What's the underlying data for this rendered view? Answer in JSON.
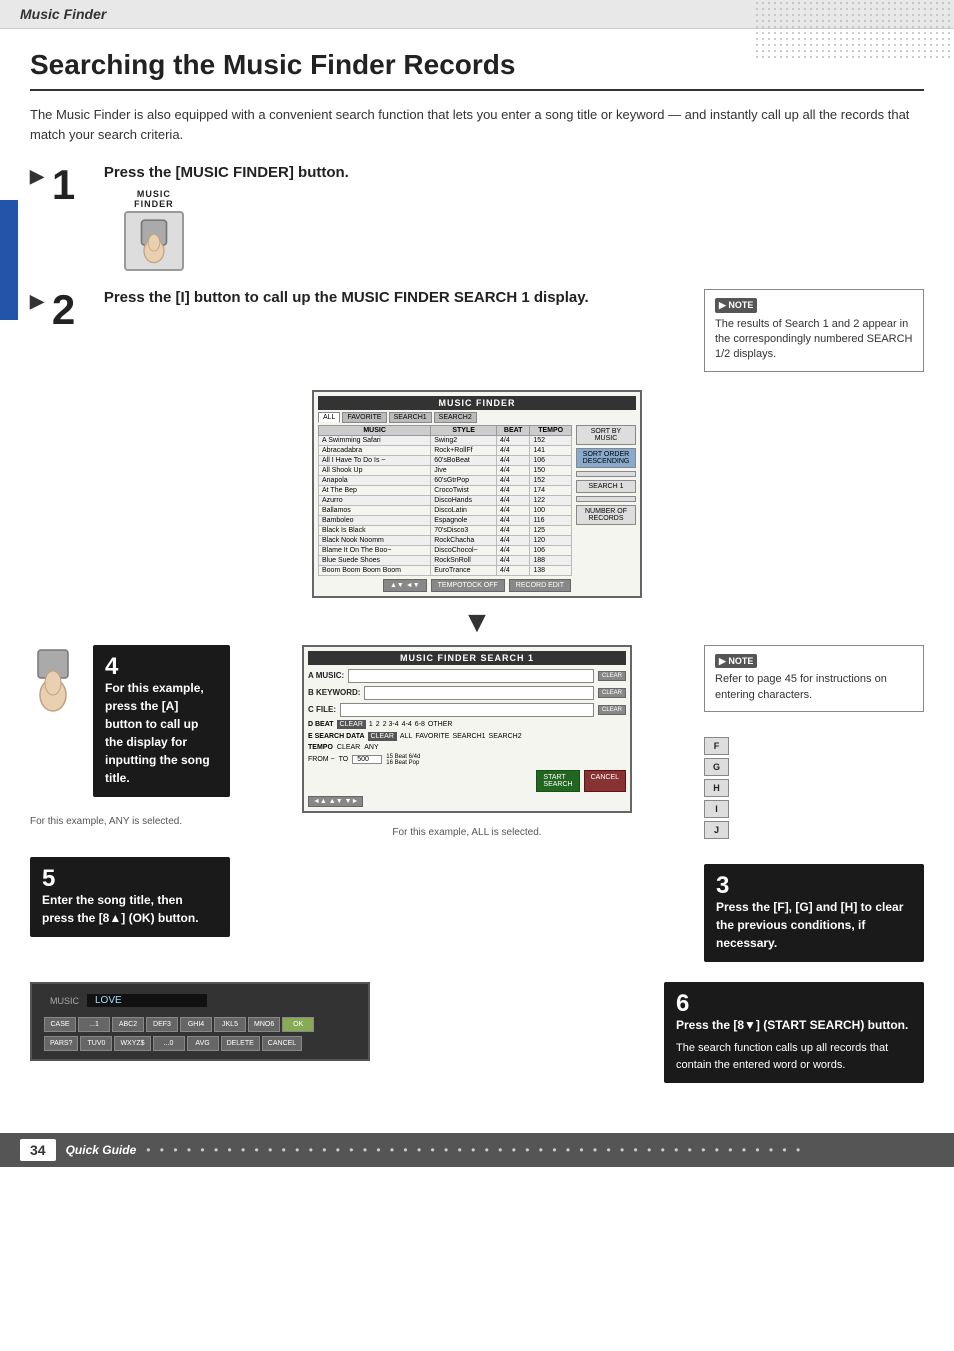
{
  "header": {
    "title": "Music Finder"
  },
  "page": {
    "title": "Searching the Music Finder Records",
    "intro": "The Music Finder is also equipped with a convenient search function that lets you enter a song title or keyword — and instantly call up all the records that match your search criteria."
  },
  "steps": {
    "step1": {
      "label": "Press the [MUSIC FINDER] button.",
      "button_label": "MUSIC\nFINDER"
    },
    "step2": {
      "label": "Press the [I] button to call up the MUSIC FINDER SEARCH 1 display.",
      "note": {
        "title": "NOTE",
        "text": "The results of Search 1 and 2 appear in the correspondingly numbered SEARCH 1/2 displays."
      }
    },
    "step3": {
      "label": "Press the [F], [G] and [H] to clear the previous conditions, if necessary."
    },
    "step4": {
      "label": "For this example, press the [A] button to call up the display for inputting the song title.",
      "note_below": "For this example, ANY is selected."
    },
    "step5": {
      "label": "Enter the song title, then press the [8▲] (OK) button.",
      "note_below": "For this example, ALL is selected."
    },
    "step6": {
      "label": "Press the [8▼] (START SEARCH) button.",
      "desc": "The search function calls up all records that contain the entered word or words."
    }
  },
  "music_finder_display": {
    "title": "MUSIC FINDER",
    "tabs": [
      "ALL",
      "FAVORITE",
      "SEARCH1",
      "SEARCH2"
    ],
    "columns": [
      "MUSIC",
      "STYLE",
      "BEAT",
      "TEMPO"
    ],
    "rows": [
      [
        "A Swimming Safari",
        "Swing2",
        "4/4",
        "152"
      ],
      [
        "Abracadabra",
        "Rock+RollFf",
        "4/4",
        "141"
      ],
      [
        "All I Have To Do Is ~",
        "60'sBoBeat",
        "4/4",
        "106"
      ],
      [
        "All Shook Up",
        "Jive",
        "4/4",
        "150"
      ],
      [
        "Anapola",
        "60'sGtrPop",
        "4/4",
        "152"
      ],
      [
        "At The Bep",
        "CrocoTwist",
        "4/4",
        "174"
      ],
      [
        "Azurro",
        "DiscoHands",
        "4/4",
        "122"
      ],
      [
        "Ballamos",
        "DiscoLatin",
        "4/4",
        "100"
      ],
      [
        "Bamboleo",
        "Espagnole",
        "4/4",
        "116"
      ],
      [
        "Black Is Black",
        "70'sDisco3",
        "4/4",
        "125"
      ],
      [
        "Black Nook Noomm",
        "RockChacha",
        "4/4",
        "120"
      ],
      [
        "Blame It On The Boo~",
        "DiscoChocol~",
        "4/4",
        "106"
      ],
      [
        "Blue Suede Shoes",
        "RockSnRoll",
        "4/4",
        "188"
      ],
      [
        "Boom Boom Boom Boom",
        "EuroTrance",
        "4/4",
        "138"
      ]
    ],
    "sidebar_buttons": [
      "SORT BY MUSIC",
      "SORT ORDER DESCENDING",
      "",
      "SEARCH 1",
      "",
      "NUMBER OF RECORDS"
    ]
  },
  "search1_display": {
    "title": "MUSIC FINDER SEARCH 1",
    "fields": [
      {
        "label": "A",
        "name": "MUSIC:",
        "value": ""
      },
      {
        "label": "B",
        "name": "KEYWORD:",
        "value": ""
      },
      {
        "label": "C",
        "name": "FILE:",
        "value": ""
      }
    ],
    "beat_options": [
      "1",
      "2",
      "2 3-4",
      "4-4",
      "6-8",
      "OTHER"
    ],
    "buttons": [
      "SEARCH DATA",
      "ALL",
      "FAVORITE",
      "SEARCH1",
      "SEARCH2"
    ],
    "tempo_label": "TEMPO",
    "from_label": "FROM",
    "to_label": "TO",
    "from_val": "500",
    "to_val": "15 Beat 6/4d\n16 Beat Pop",
    "side_labels": [
      "F",
      "G",
      "H",
      "I",
      "J"
    ],
    "clear_labels": [
      "CLEAR",
      "CLEAR",
      "CLEAR"
    ]
  },
  "keyboard": {
    "display_label": "MUSIC",
    "input_value": "LOVE",
    "row1": [
      "CASE",
      "...1",
      "ABC2",
      "DEF3",
      "GHI4",
      "JKL5",
      "MNO6",
      "OK"
    ],
    "row2": [
      "PARS?",
      "TUV0",
      "WXYZ$",
      "...0",
      "AVG",
      "DELETE",
      "CANCEL"
    ]
  },
  "note2": {
    "title": "NOTE",
    "text": "Refer to page 45 for instructions on entering characters."
  },
  "footer": {
    "page_number": "34",
    "label": "Quick Guide",
    "dots": "• • • • • • • • • • • • • • • • • • • • • • • • • • • • • • • • • • • • • • • • • • • • • • • • •"
  }
}
